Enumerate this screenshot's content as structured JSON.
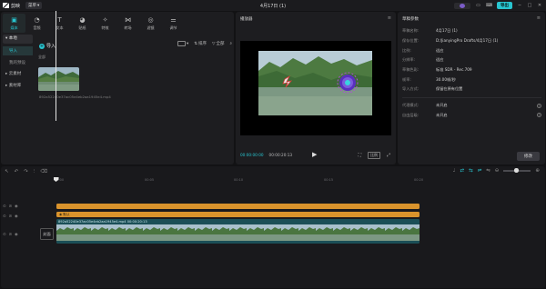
{
  "titlebar": {
    "app_name": "剪映",
    "menu_label": "菜单",
    "window_title": "4月17日 (1)",
    "export_label": "导出",
    "colors": {
      "accent": "#28c4cf"
    }
  },
  "toolbar": {
    "items": [
      {
        "label": "媒体",
        "icon": "media-icon"
      },
      {
        "label": "音频",
        "icon": "audio-icon"
      },
      {
        "label": "文本",
        "icon": "text-icon"
      },
      {
        "label": "贴纸",
        "icon": "sticker-icon"
      },
      {
        "label": "特效",
        "icon": "effects-icon"
      },
      {
        "label": "转场",
        "icon": "transition-icon"
      },
      {
        "label": "滤镜",
        "icon": "filter-icon"
      },
      {
        "label": "调节",
        "icon": "adjust-icon"
      }
    ]
  },
  "sidebar": {
    "local": "本地",
    "import": "导入",
    "my_presets": "我的预设",
    "cloud": "云素材",
    "library": "素材库"
  },
  "media": {
    "import_label": "导入",
    "section_label": "全部",
    "sort_label": "排序",
    "filter_label": "全部",
    "clip_name": "892a52240e37ac05e4eb2aa1945e4.mp4"
  },
  "player": {
    "title": "播放器",
    "time_current": "00:00:00:00",
    "time_total": "00:00:20:13",
    "ratio_label": "比例"
  },
  "properties": {
    "title": "草稿参数",
    "rows": [
      {
        "key": "草稿名称:",
        "value": "4月17日 (1)"
      },
      {
        "key": "保存位置:",
        "value": "D:/JianyingPro Drafts/4月17日 (1)"
      },
      {
        "key": "比例:",
        "value": "适应"
      },
      {
        "key": "分辨率:",
        "value": "适应"
      },
      {
        "key": "草稿色彩:",
        "value": "标准 SDR - Rec.709"
      },
      {
        "key": "帧率:",
        "value": "30.00帧/秒"
      },
      {
        "key": "导入方式:",
        "value": "保留在原有位置"
      }
    ],
    "rows2": [
      {
        "key": "代理模式:",
        "value": "未开启"
      },
      {
        "key": "自由层级:",
        "value": "未开启"
      }
    ],
    "modify_label": "修改"
  },
  "timeline": {
    "ruler": [
      "00:00",
      "00:05",
      "00:10",
      "00:15",
      "00:20"
    ],
    "text_track_label": "默认",
    "video_track_label": "892a52240e37ac05e4eb2aa1945e4.mp4  00:00:20:13",
    "cover_label": "封面"
  }
}
